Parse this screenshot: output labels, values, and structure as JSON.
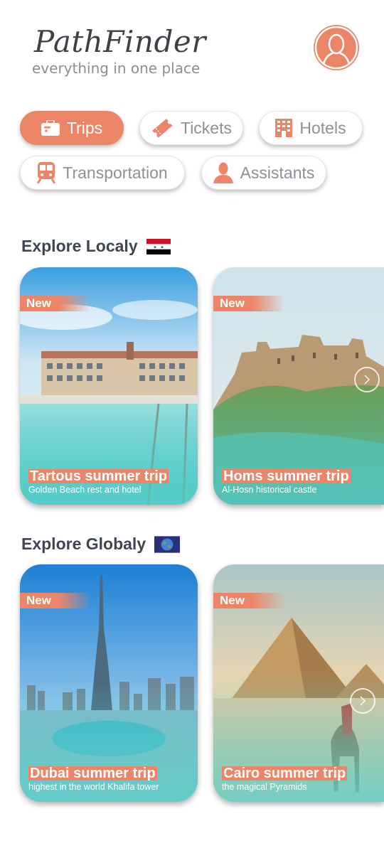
{
  "app": {
    "title": "PathFinder",
    "tagline": "everything in one place",
    "accent": "#ec8567"
  },
  "categories": [
    {
      "label": "Trips",
      "icon": "suitcase-icon",
      "active": true
    },
    {
      "label": "Tickets",
      "icon": "ticket-icon",
      "active": false
    },
    {
      "label": "Hotels",
      "icon": "hotel-icon",
      "active": false
    },
    {
      "label": "Transportation",
      "icon": "train-icon",
      "active": false
    },
    {
      "label": "Assistants",
      "icon": "person-icon",
      "active": false
    }
  ],
  "local": {
    "heading": "Explore Localy",
    "flag": "syria-flag-icon",
    "trips": [
      {
        "badge": "New",
        "title": "Tartous summer trip",
        "subtitle": "Golden Beach rest and hotel"
      },
      {
        "badge": "New",
        "title": "Homs summer trip",
        "subtitle": "Al-Hosn historical castle"
      }
    ]
  },
  "global": {
    "heading": "Explore Globaly",
    "flag": "globe-flag-icon",
    "trips": [
      {
        "badge": "New",
        "title": "Dubai summer trip",
        "subtitle": "highest in the world Khalifa tower"
      },
      {
        "badge": "New",
        "title": "Cairo summer trip",
        "subtitle": "the magical Pyramids"
      }
    ]
  }
}
